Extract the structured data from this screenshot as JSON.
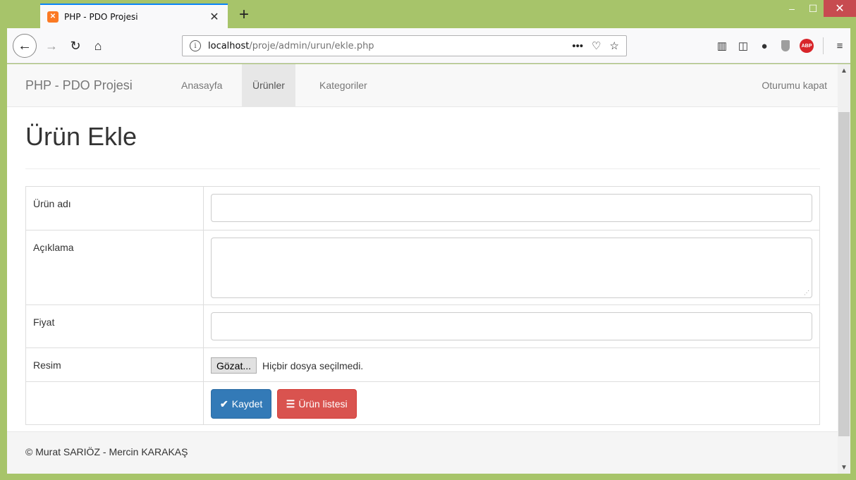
{
  "browser": {
    "tab_title": "PHP - PDO Projesi",
    "favicon": "xampp-icon",
    "url_host": "localhost",
    "url_path": "/proje/admin/urun/ekle.php"
  },
  "navbar": {
    "brand": "PHP - PDO Projesi",
    "links": [
      {
        "label": "Anasayfa",
        "active": false
      },
      {
        "label": "Ürünler",
        "active": true
      },
      {
        "label": "Kategoriler",
        "active": false
      }
    ],
    "logout": "Oturumu kapat"
  },
  "page": {
    "title": "Ürün Ekle"
  },
  "form": {
    "name_label": "Ürün adı",
    "name_value": "",
    "description_label": "Açıklama",
    "description_value": "",
    "price_label": "Fiyat",
    "price_value": "",
    "image_label": "Resim",
    "file_button": "Gözat...",
    "file_status": "Hiçbir dosya seçilmedi.",
    "save_button": "Kaydet",
    "list_button": "Ürün listesi"
  },
  "footer": {
    "text": "© Murat SARIÖZ - Mercin KARAKAŞ"
  },
  "colors": {
    "primary": "#337ab7",
    "danger": "#d9534f",
    "window_frame": "#a7c46a"
  }
}
